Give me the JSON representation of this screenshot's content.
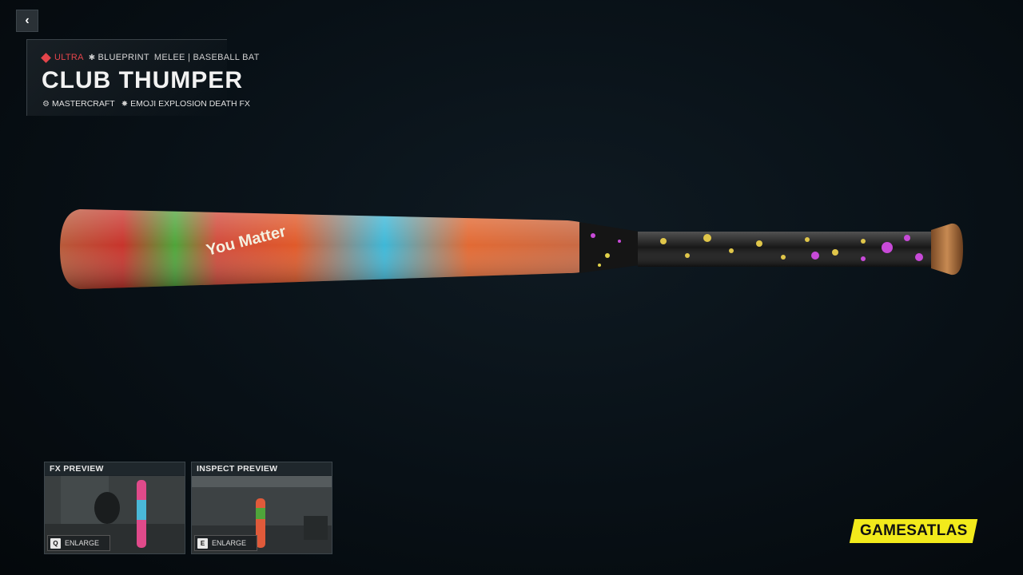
{
  "nav": {
    "back_icon": "chevron-left-icon",
    "back_glyph": "‹"
  },
  "item": {
    "rarity": "ULTRA",
    "type": "BLUEPRINT",
    "category": "MELEE | BASEBALL BAT",
    "name": "CLUB THUMPER",
    "attributes": [
      {
        "icon": "mastercraft-icon",
        "label": "MASTERCRAFT"
      },
      {
        "icon": "death-fx-icon",
        "label": "EMOJI EXPLOSION DEATH FX"
      }
    ],
    "colors": {
      "rarity": "#e4454b"
    },
    "bat_decal_text": "You Matter"
  },
  "previews": [
    {
      "title": "FX PREVIEW",
      "key": "Q",
      "action": "ENLARGE"
    },
    {
      "title": "INSPECT PREVIEW",
      "key": "E",
      "action": "ENLARGE"
    }
  ],
  "watermark": {
    "text": "GAMESATLAS",
    "color": "#f2ea1b"
  }
}
